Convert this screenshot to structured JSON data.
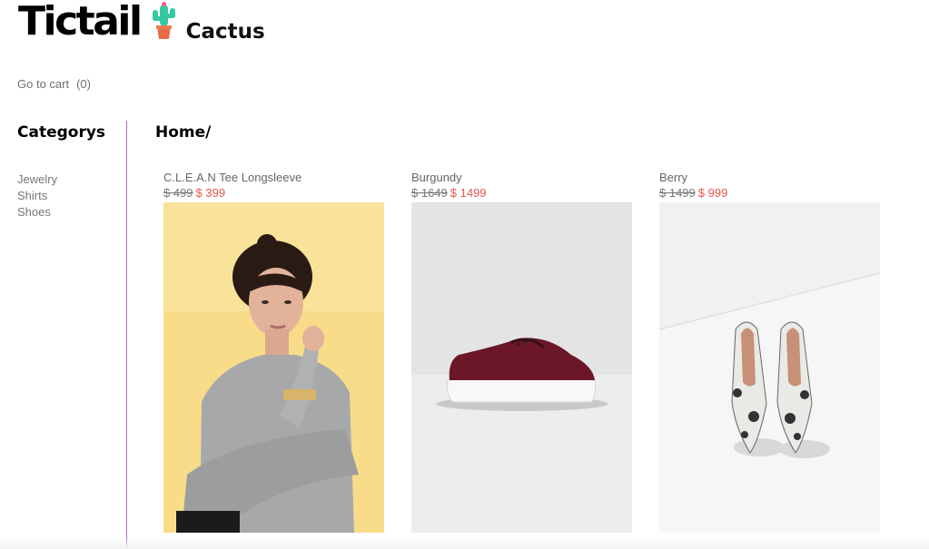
{
  "brand": {
    "name": "Tictail",
    "store": "Cactus"
  },
  "cart": {
    "label": "Go to cart",
    "count": "(0)"
  },
  "sidebar": {
    "title": "Categorys",
    "items": [
      {
        "label": "Jewelry"
      },
      {
        "label": "Shirts"
      },
      {
        "label": "Shoes"
      }
    ]
  },
  "breadcrumb": "Home/",
  "products": [
    {
      "name": "C.L.E.A.N Tee Longsleeve",
      "old_price": "$ 499",
      "price": "$ 399"
    },
    {
      "name": "Burgundy",
      "old_price": "$ 1649",
      "price": "$ 1499"
    },
    {
      "name": "Berry",
      "old_price": "$ 1499",
      "price": "$ 999"
    }
  ],
  "colors": {
    "accent_divider": "#b06ed0",
    "sale_price": "#e8564b"
  }
}
